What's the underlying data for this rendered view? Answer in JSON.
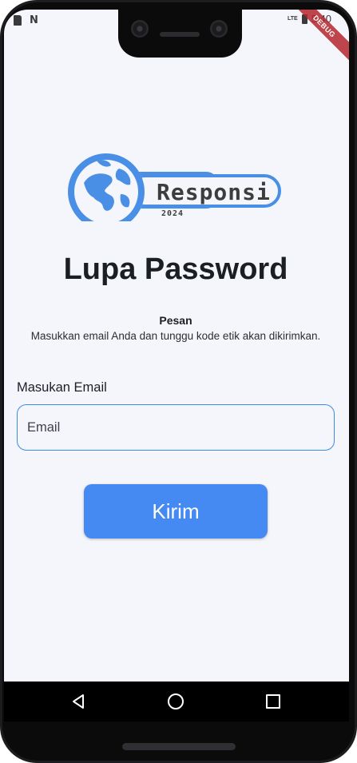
{
  "status_bar": {
    "left_icons": [
      "sd-card-icon",
      "n-icon"
    ],
    "network": "LTE",
    "time": "5:40",
    "debug_banner": "DEBUG"
  },
  "logo": {
    "name": "Responsi",
    "year": "2024",
    "colors": {
      "globe": "#4a8fe6",
      "text": "#3d3d3d"
    }
  },
  "page": {
    "title": "Lupa Password",
    "message_title": "Pesan",
    "message_body": "Masukkan email Anda dan tunggu kode etik akan dikirimkan."
  },
  "form": {
    "email_label": "Masukan Email",
    "email_placeholder": "Email",
    "email_value": "",
    "submit_label": "Kirim"
  },
  "nav_bar": {
    "icons": [
      "back-icon",
      "home-icon",
      "recent-apps-icon"
    ]
  },
  "colors": {
    "accent": "#4589f2",
    "input_border": "#3b8be3",
    "background": "#f5f6fb"
  }
}
